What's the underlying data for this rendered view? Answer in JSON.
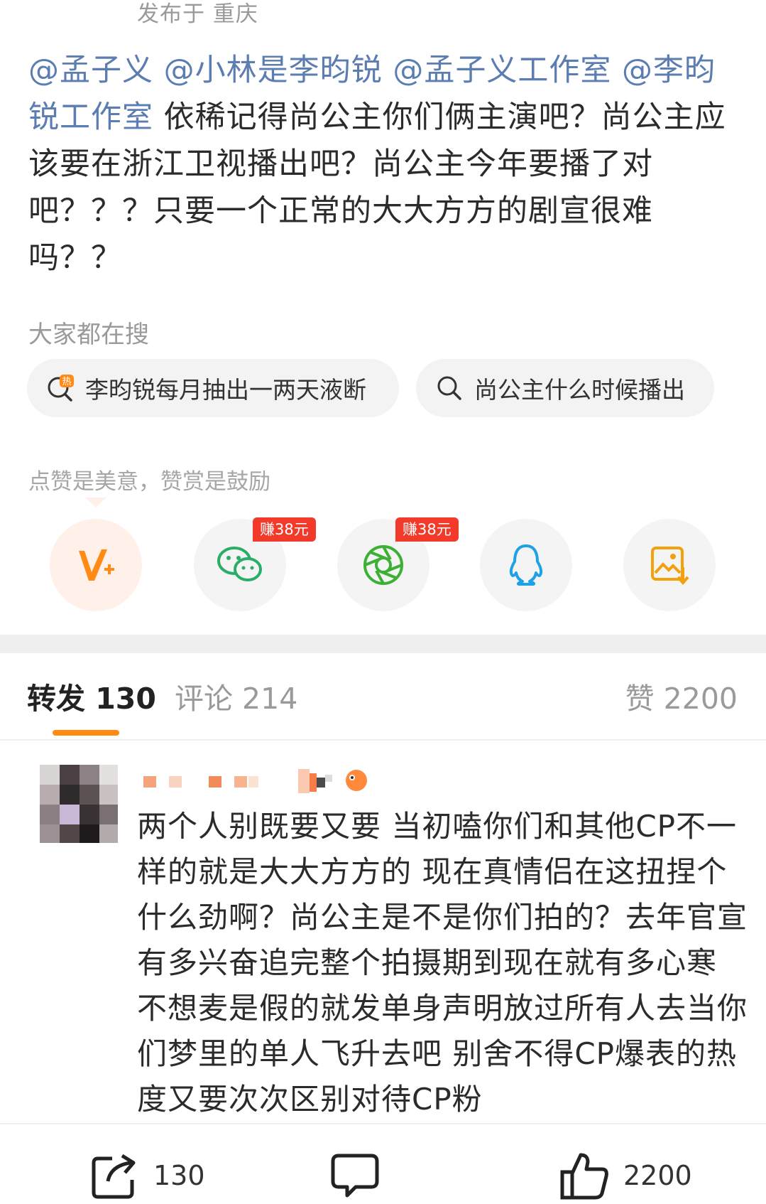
{
  "post": {
    "location": "发布于 重庆",
    "mentions": [
      "@孟子义",
      "@小林是李昀锐",
      "@孟子义工作室",
      "@李昀锐工作室"
    ],
    "body": "依稀记得尚公主你们俩主演吧？尚公主应该要在浙江卫视播出吧？尚公主今年要播了对吧？？？只要一个正常的大大方方的剧宣很难吗？？"
  },
  "search": {
    "label": "大家都在搜",
    "chips": [
      {
        "icon": "hot-search-icon",
        "text": "李昀锐每月抽出一两天液断"
      },
      {
        "icon": "search-icon",
        "text": "尚公主什么时候播出"
      }
    ]
  },
  "share": {
    "hint": "点赞是美意，赞赏是鼓励",
    "buttons": [
      {
        "name": "vip-reward",
        "icon": "v-plus-icon"
      },
      {
        "name": "wechat",
        "icon": "wechat-icon",
        "badge": "赚38元"
      },
      {
        "name": "moments",
        "icon": "moments-icon",
        "badge": "赚38元"
      },
      {
        "name": "qq",
        "icon": "qq-icon"
      },
      {
        "name": "save-image",
        "icon": "save-image-icon"
      }
    ]
  },
  "tabs": [
    {
      "label": "转发",
      "count": "130",
      "active": true
    },
    {
      "label": "评论",
      "count": "214",
      "active": false
    },
    {
      "label": "赞",
      "count": "2200",
      "active": false
    }
  ],
  "comment": {
    "text": "两个人别既要又要 当初嗑你们和其他CP不一样的就是大大方方的 现在真情侣在这扭捏个什么劲啊？尚公主是不是你们拍的？去年官宣有多兴奋追完整个拍摄期到现在就有多心寒 不想麦是假的就发单身声明放过所有人去当你们梦里的单人飞升去吧 别舍不得CP爆表的热度又要次次区别对待CP粉"
  },
  "bottom_bar": {
    "repost_count": "130",
    "like_count": "2200"
  },
  "colors": {
    "mention": "#5b7db1",
    "accent": "#ff8a14",
    "badge": "#f23a2b"
  }
}
